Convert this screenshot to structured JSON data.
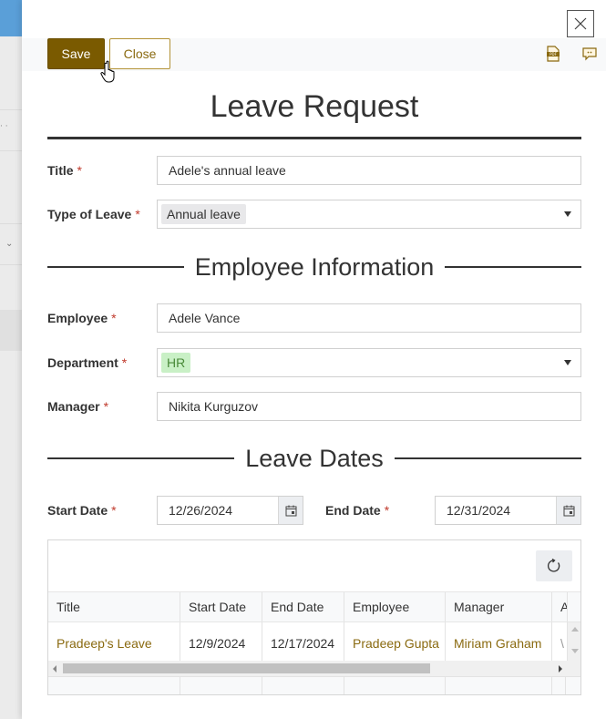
{
  "toolbar": {
    "save_label": "Save",
    "close_label": "Close",
    "icons": [
      "pdf-icon",
      "comment-icon"
    ]
  },
  "form": {
    "title": "Leave Request",
    "fields": {
      "title": {
        "label": "Title",
        "required": "*",
        "value": "Adele's annual leave"
      },
      "type_of_leave": {
        "label": "Type of Leave",
        "required": "*",
        "value": "Annual leave"
      },
      "employee": {
        "label": "Employee",
        "required": "*",
        "value": "Adele Vance"
      },
      "department": {
        "label": "Department",
        "required": "*",
        "value": "HR"
      },
      "manager": {
        "label": "Manager",
        "required": "*",
        "value": "Nikita Kurguzov"
      },
      "start_date": {
        "label": "Start Date",
        "required": "*",
        "value": "12/26/2024"
      },
      "end_date": {
        "label": "End Date",
        "required": "*",
        "value": "12/31/2024"
      }
    },
    "sections": {
      "employee_info": "Employee Information",
      "leave_dates": "Leave Dates"
    }
  },
  "colors": {
    "accent": "#7a5a00",
    "link": "#8a6a10",
    "department_chip_bg": "#c9f0c6",
    "department_chip_text": "#4a8a3a"
  },
  "grid": {
    "columns": [
      "Title",
      "Start Date",
      "End Date",
      "Employee",
      "Manager",
      "A"
    ],
    "rows": [
      {
        "title": "Pradeep's Leave",
        "start_date": "12/9/2024",
        "end_date": "12/17/2024",
        "employee": "Pradeep Gupta",
        "manager": "Miriam Graham",
        "extra": "\\"
      }
    ]
  }
}
